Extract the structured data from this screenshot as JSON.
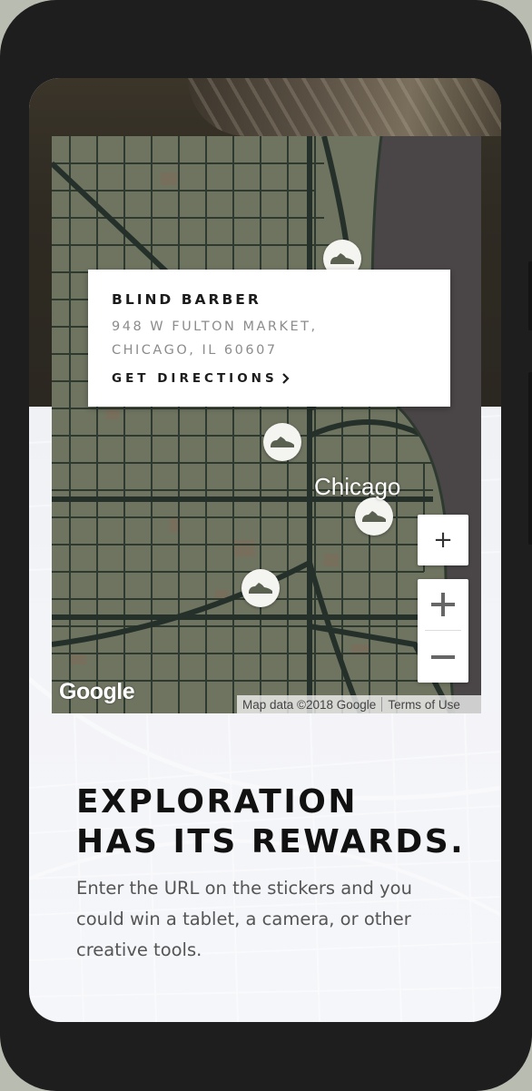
{
  "location_card": {
    "name": "BLIND BARBER",
    "address_line1": "948 W FULTON MARKET,",
    "address_line2": "CHICAGO, IL 60607",
    "directions_label": "GET DIRECTIONS"
  },
  "map": {
    "city_label": "Chicago",
    "logo": "Google",
    "attribution": "Map data ©2018 Google",
    "terms_label": "Terms of Use",
    "zoom_single_label": "+",
    "zoom_in_label": "+",
    "zoom_out_label": "−"
  },
  "content": {
    "headline_line1": "EXPLORATION",
    "headline_line2": "HAS ITS REWARDS.",
    "body": "Enter the URL on the stickers and you could win a tablet, a camera, or other creative tools."
  },
  "icons": {
    "map_marker": "sneaker-icon",
    "directions_chevron": "chevron-right-icon"
  },
  "colors": {
    "map_land": "#6e7460",
    "map_roads": "#2e3a30",
    "lake": "#4a4648",
    "marker_bg": "#f4f4f0"
  }
}
